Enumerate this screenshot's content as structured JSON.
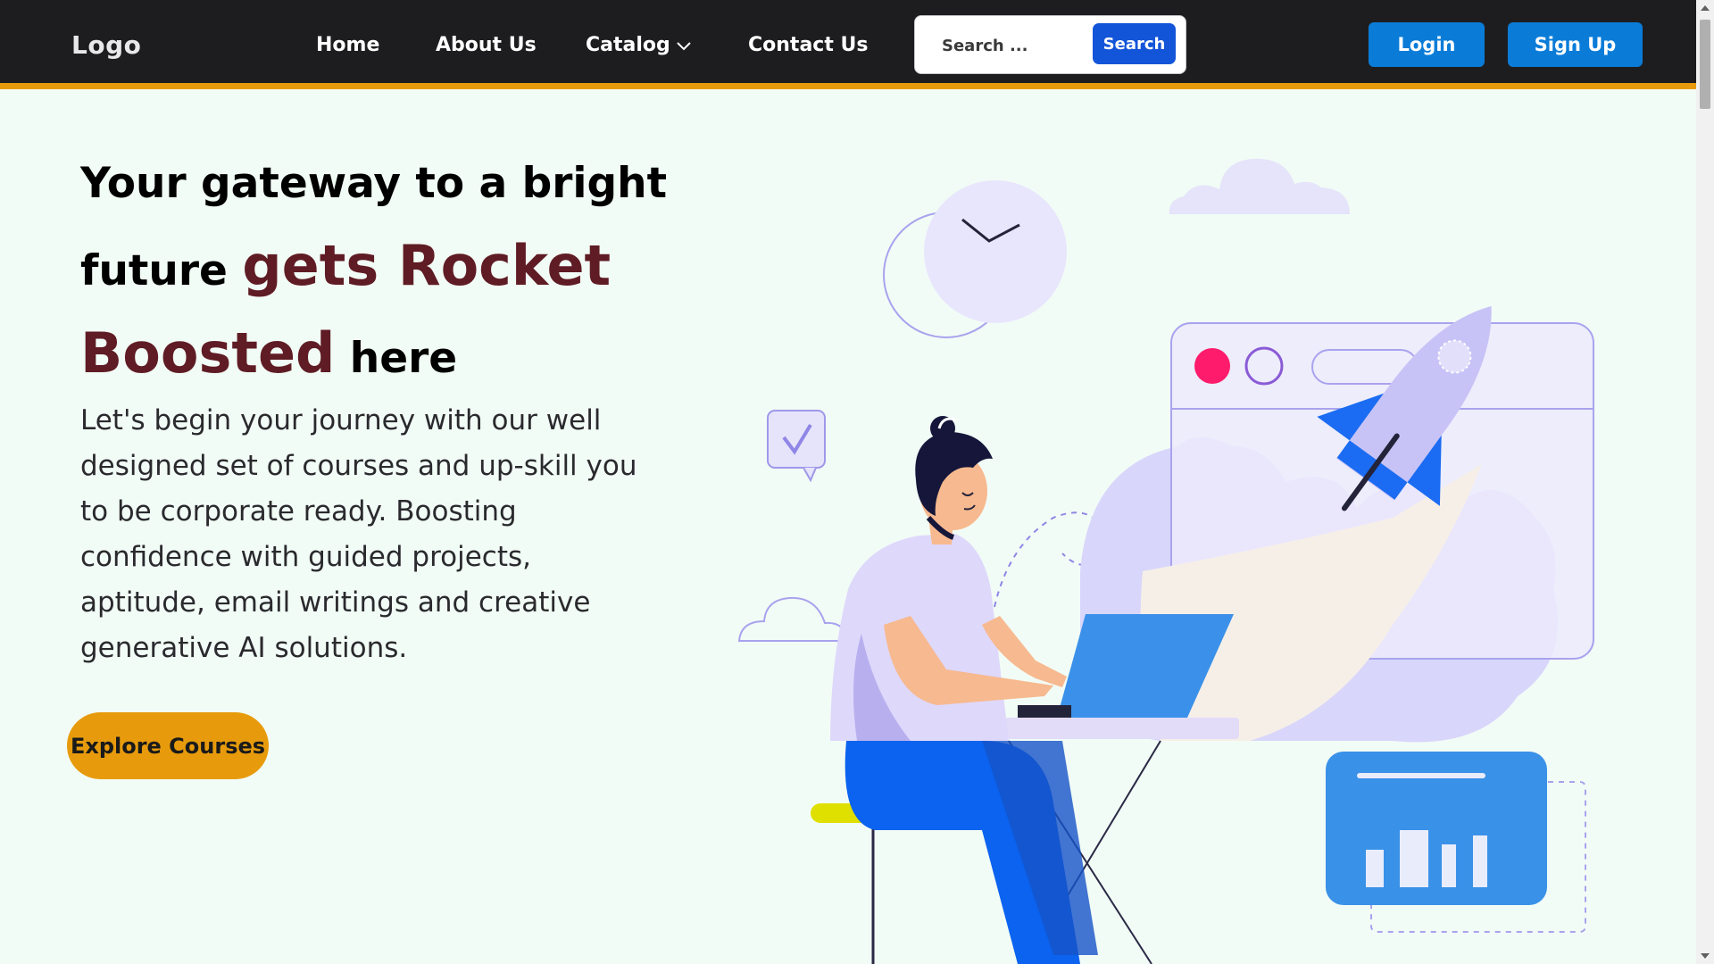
{
  "navbar": {
    "logo": "Logo",
    "links": [
      "Home",
      "About Us",
      "Catalog",
      "Contact Us"
    ],
    "search_placeholder": "Search ...",
    "search_button": "Search",
    "login": "Login",
    "signup": "Sign Up",
    "accent_color": "#e79b0c"
  },
  "hero": {
    "headline_part1": "Your gateway to a bright future",
    "headline_highlight": "gets Rocket Boosted",
    "headline_part2": "here",
    "paragraph": "Let's begin your journey with our well designed set of courses and up-skill you to be corporate ready. Boosting confidence with guided projects, aptitude, email writings and creative generative AI solutions.",
    "cta": "Explore Courses",
    "highlight_color": "#5f1c24"
  },
  "icons": [
    "chevron-down-icon",
    "clock-icon",
    "check-message-icon",
    "rocket-icon",
    "chart-icon"
  ]
}
